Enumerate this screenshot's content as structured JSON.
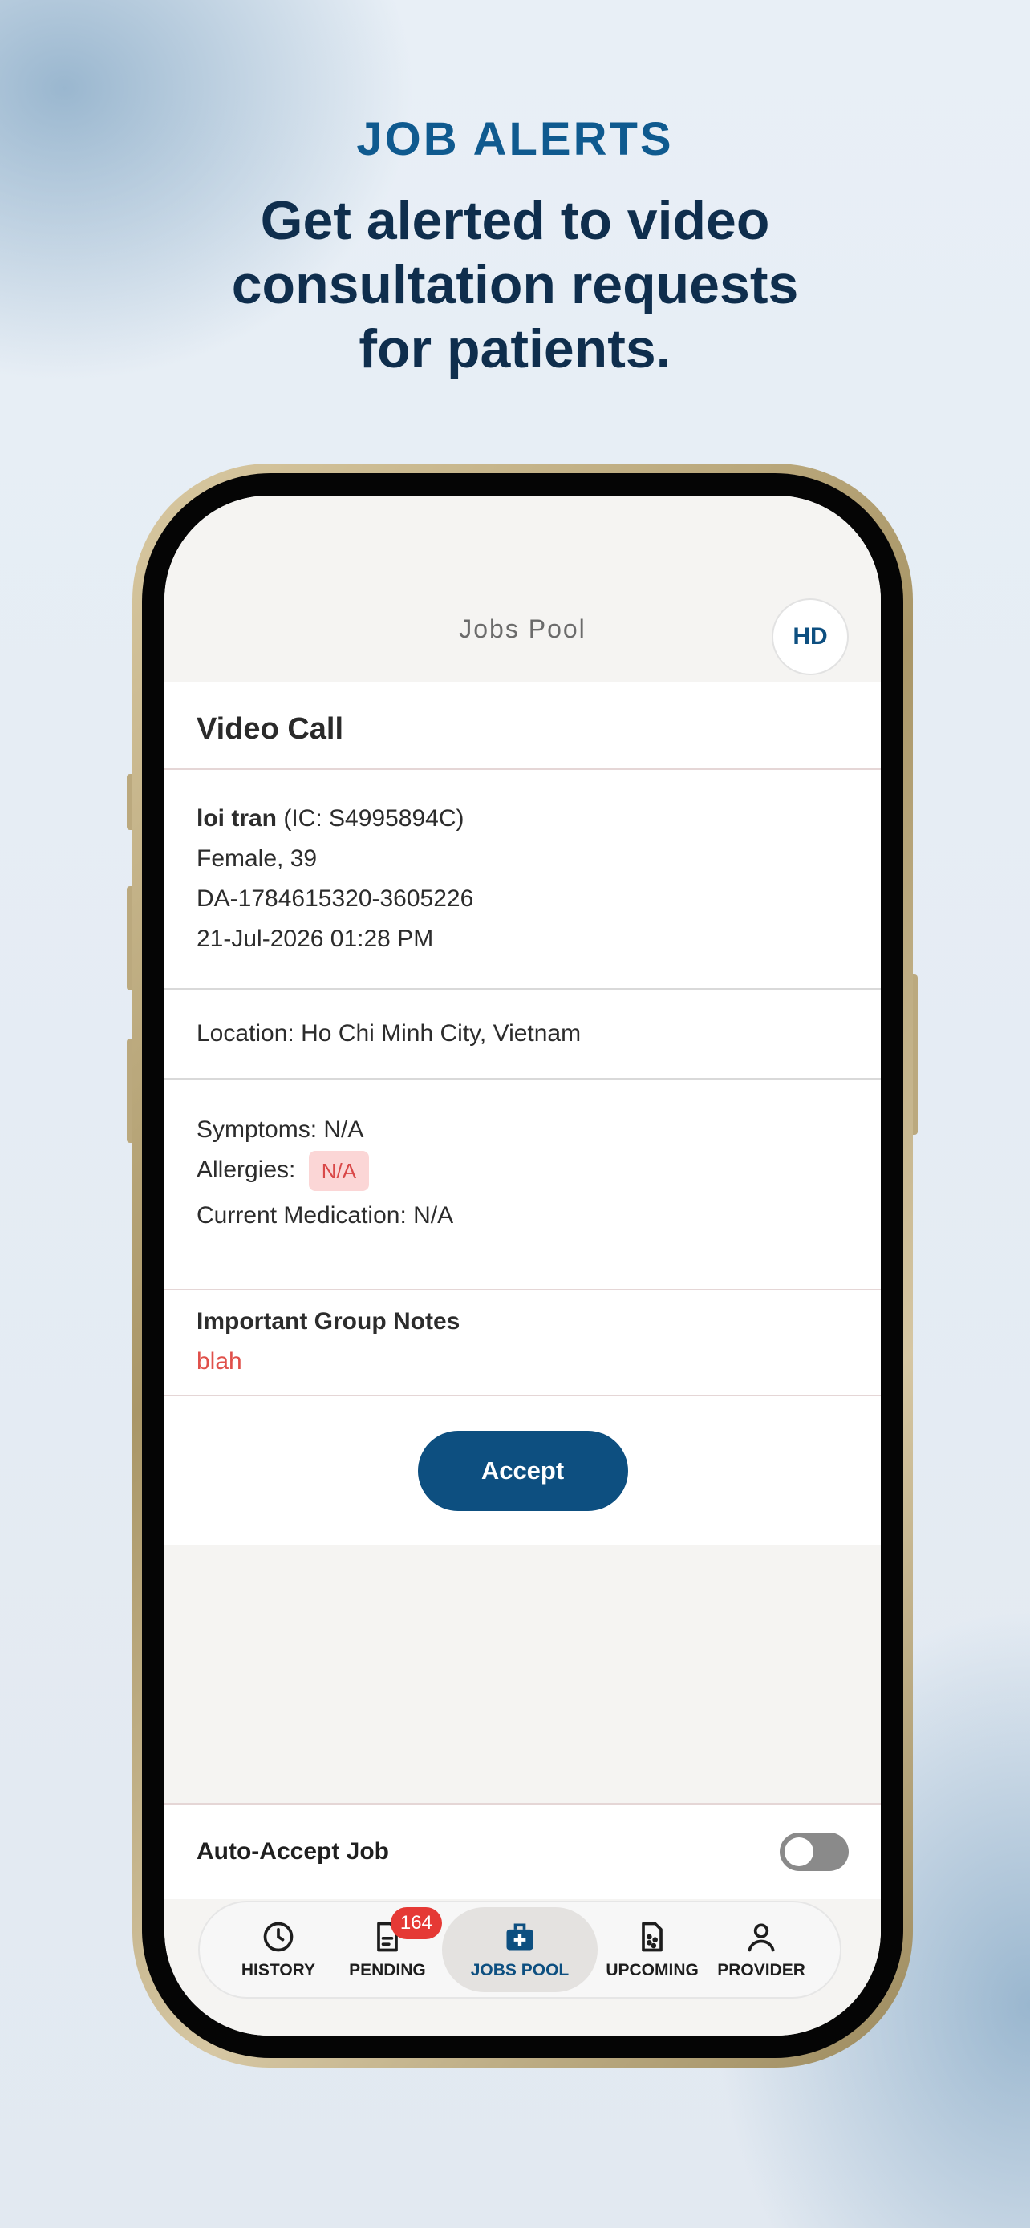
{
  "header": {
    "kicker": "JOB ALERTS",
    "title": "Get alerted to video consultation requests for patients."
  },
  "app": {
    "title": "Jobs Pool",
    "avatar_initials": "HD"
  },
  "job": {
    "type": "Video Call",
    "patient_name": "loi tran",
    "ic": "(IC: S4995894C)",
    "gender_age": "Female, 39",
    "job_id": "DA-1784615320-3605226",
    "datetime": "21-Jul-2026 01:28 PM",
    "location": "Location: Ho Chi Minh City, Vietnam",
    "symptoms": "Symptoms: N/A",
    "allergies_label": "Allergies:",
    "allergies_value": "N/A",
    "medication": "Current Medication: N/A",
    "notes_title": "Important Group Notes",
    "notes_body": "blah",
    "accept_label": "Accept"
  },
  "auto_accept": {
    "label": "Auto-Accept Job",
    "enabled": false
  },
  "tabs": [
    {
      "label": "HISTORY",
      "icon": "clock-icon"
    },
    {
      "label": "PENDING",
      "icon": "document-icon",
      "badge": "164"
    },
    {
      "label": "JOBS POOL",
      "icon": "medical-bag-icon",
      "active": true
    },
    {
      "label": "UPCOMING",
      "icon": "dotted-document-icon"
    },
    {
      "label": "PROVIDER",
      "icon": "person-icon"
    }
  ],
  "colors": {
    "brand": "#0d4f80",
    "alert": "#e53935",
    "note": "#e0504a"
  }
}
